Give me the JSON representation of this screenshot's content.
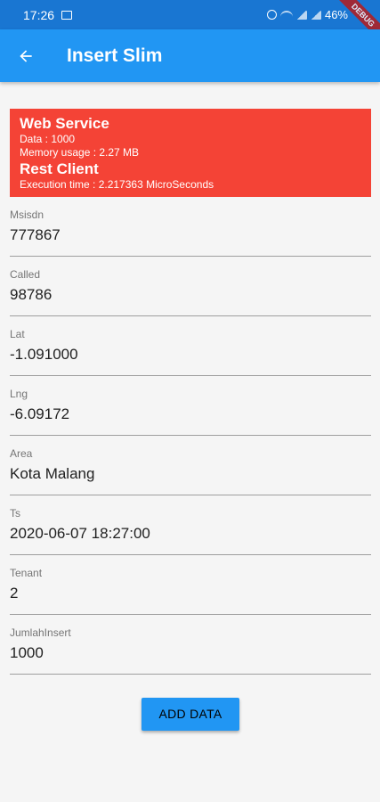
{
  "status_bar": {
    "time": "17:26",
    "battery": "46%"
  },
  "debug_banner": "DEBUG",
  "app_bar": {
    "title": "Insert Slim"
  },
  "info": {
    "web_service_heading": "Web Service",
    "data_line": "Data : 1000",
    "memory_line": "Memory usage : 2.27 MB",
    "rest_client_heading": "Rest Client",
    "execution_line": "Execution time : 2.217363 MicroSeconds"
  },
  "fields": [
    {
      "label": "Msisdn",
      "value": "777867"
    },
    {
      "label": "Called",
      "value": "98786"
    },
    {
      "label": "Lat",
      "value": "-1.091000"
    },
    {
      "label": "Lng",
      "value": "-6.09172"
    },
    {
      "label": "Area",
      "value": "Kota Malang"
    },
    {
      "label": "Ts",
      "value": "2020-06-07 18:27:00"
    },
    {
      "label": "Tenant",
      "value": "2"
    },
    {
      "label": "JumlahInsert",
      "value": "1000"
    }
  ],
  "add_button": "ADD DATA"
}
